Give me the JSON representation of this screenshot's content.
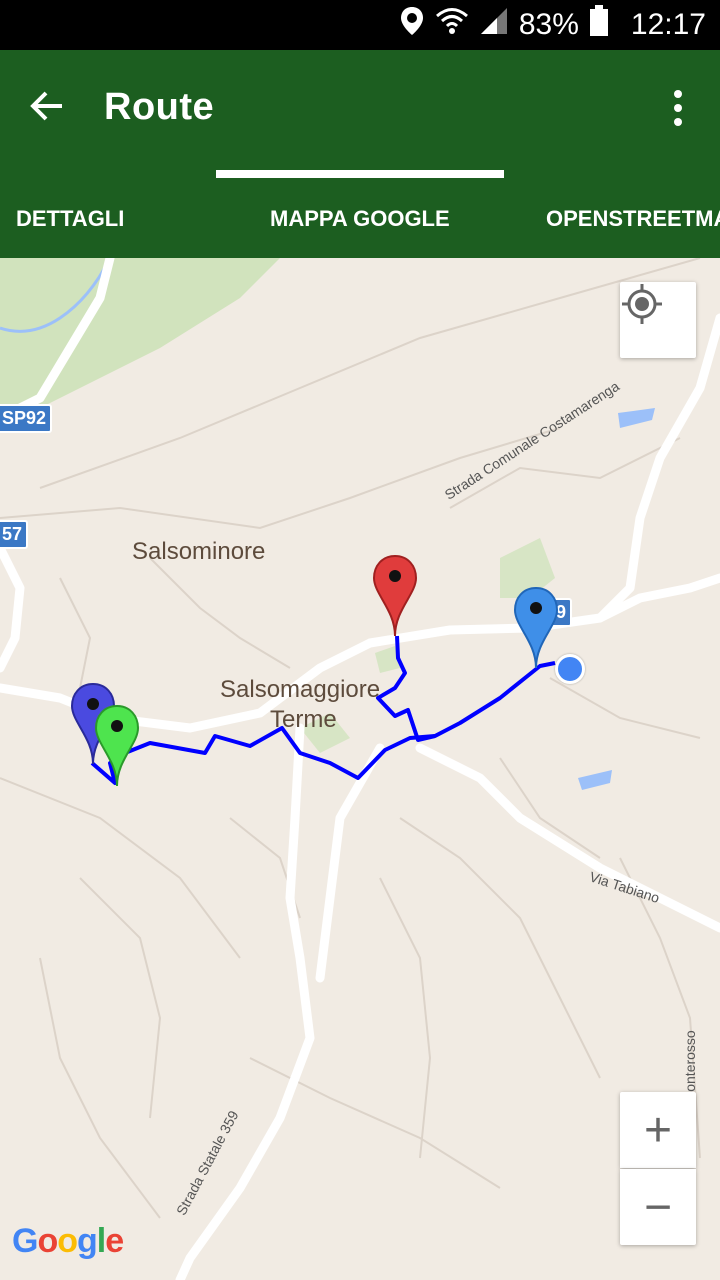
{
  "status": {
    "battery": "83%",
    "time": "12:17",
    "icons": [
      "location-icon",
      "wifi-icon",
      "signal-icon",
      "battery-icon"
    ]
  },
  "appbar": {
    "title": "Route",
    "back_icon": "arrow-back-icon",
    "menu_icon": "more-vert-icon"
  },
  "tabs": [
    {
      "label": "DETTAGLI",
      "selected": false
    },
    {
      "label": "MAPPA GOOGLE",
      "selected": true
    },
    {
      "label": "OPENSTREETMA",
      "selected": false
    }
  ],
  "map": {
    "places": {
      "town1": "Salsominore",
      "town2_line1": "Salsomaggiore",
      "town2_line2": "Terme"
    },
    "streets": {
      "s1": "Strada Comunale Costamarenga",
      "s2": "Via Tabiano",
      "s3": "Strada Statale 359",
      "s4": "Str. Ponterosso"
    },
    "road_badges": {
      "b1": "SP92",
      "b2": "57",
      "b3": "9"
    },
    "markers": [
      {
        "name": "blue-purple",
        "color": "#4a4ae0"
      },
      {
        "name": "green",
        "color": "#4ee44e"
      },
      {
        "name": "red",
        "color": "#e03c3c"
      },
      {
        "name": "light-blue",
        "color": "#3f8fe8"
      }
    ],
    "route_color": "#0000ff",
    "controls": {
      "zoom_in": "+",
      "zoom_out": "−"
    },
    "logo": "Google"
  }
}
